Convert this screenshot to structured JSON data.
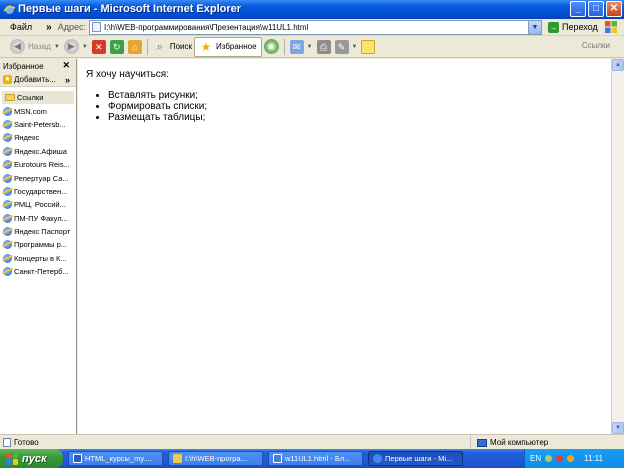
{
  "window": {
    "title": "Первые шаги - Microsoft Internet Explorer",
    "controls": {
      "minimize": "_",
      "maximize": "□",
      "close": "✕"
    }
  },
  "menubar": {
    "file": "Файл",
    "more": "»",
    "address_label": "Адрес:",
    "address_value": "I:\\h\\WEB-программирования\\Презентация\\w11UL1.html",
    "go_label": "Переход"
  },
  "toolbar": {
    "back_label": "Назад",
    "search_label": "Поиск",
    "favorites_label": "Избранное",
    "links_label": "Ссылки"
  },
  "favorites_panel": {
    "header": "Избранное",
    "close": "✕",
    "add_label": "Добавить...",
    "more": "»",
    "items": [
      {
        "label": "Ссылки",
        "icon": "folder-icon"
      },
      {
        "label": "MSN.com",
        "icon": "ie-page-icon"
      },
      {
        "label": "Saint-Petersb...",
        "icon": "ie-page-icon"
      },
      {
        "label": "Яндекс",
        "icon": "ie-page-icon"
      },
      {
        "label": "Яндекс.Афиша",
        "icon": "ie-page-icon"
      },
      {
        "label": "Eurotours Reis...",
        "icon": "ie-page-icon"
      },
      {
        "label": "Репертуар Са...",
        "icon": "ie-page-icon"
      },
      {
        "label": "Государствен...",
        "icon": "ie-page-icon"
      },
      {
        "label": "РМЦ. Россий...",
        "icon": "ie-page-icon"
      },
      {
        "label": "ПМ-ПУ Факул...",
        "icon": "ie-page-icon"
      },
      {
        "label": "Яндекс Паспорт",
        "icon": "ie-page-icon"
      },
      {
        "label": "Программы р...",
        "icon": "ie-page-icon"
      },
      {
        "label": "Концерты в К...",
        "icon": "ie-page-icon"
      },
      {
        "label": "Санкт-Петерб...",
        "icon": "ie-page-icon"
      }
    ]
  },
  "page": {
    "intro": "Я хочу научиться:",
    "list": [
      "Вставлять рисунки;",
      "Формировать списки;",
      "Размещать таблицы;"
    ]
  },
  "statusbar": {
    "status": "Готово",
    "zone": "Мой компьютер"
  },
  "taskbar": {
    "start": "пуск",
    "tasks": [
      {
        "label": "HTML_курсы_my....",
        "color": "#2b5fbf"
      },
      {
        "label": "I:\\h\\WEB-програ...",
        "color": "#f2c94c"
      },
      {
        "label": "w11UL1.html - Бл...",
        "color": "#4a7fd8"
      },
      {
        "label": "Первые шаги - Mi...",
        "color": "#3f8ae8"
      }
    ],
    "lang": "EN",
    "clock": "11:11"
  },
  "colors": {
    "titlebar": "#0a5fe0",
    "taskbar": "#245edb",
    "start": "#3a9a3a"
  }
}
